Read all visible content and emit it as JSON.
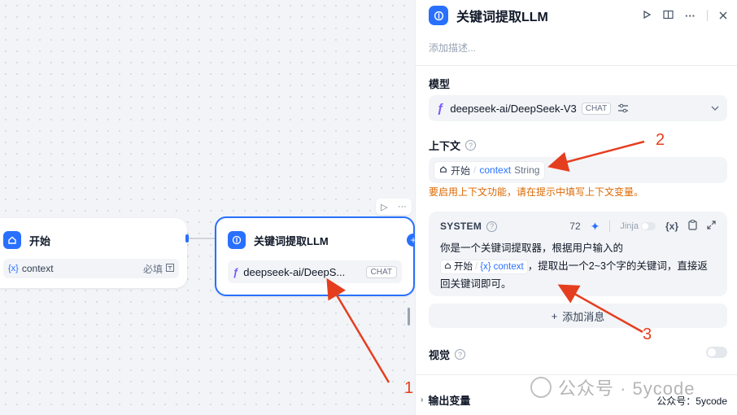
{
  "canvas": {
    "start_node": {
      "title": "开始",
      "var_icon": "{x}",
      "var_name": "context",
      "required": "必填"
    },
    "llm_node": {
      "title": "关键词提取LLM",
      "model": "deepseek-ai/DeepS...",
      "badge": "CHAT"
    },
    "node_tools": {
      "run": "▷",
      "more": "···"
    },
    "plus": "+"
  },
  "panel": {
    "title": "关键词提取LLM",
    "description_placeholder": "添加描述...",
    "model_section": {
      "label": "模型",
      "model_name": "deepseek-ai/DeepSeek-V3",
      "badge": "CHAT"
    },
    "context_section": {
      "label": "上下文",
      "node": "开始",
      "var": "context",
      "type": "String",
      "warning": "要启用上下文功能，请在提示中填写上下文变量。"
    },
    "system_section": {
      "label": "SYSTEM",
      "count": "72",
      "jinja": "Jinja",
      "var_icon": "{x}",
      "text_before": "你是一个关键词提取器，根据用户输入的",
      "chip_node": "开始",
      "chip_var_icon": "{x}",
      "chip_var": "context",
      "text_after": "，提取出一个2~3个字的关键词，直接返回关键词即可。"
    },
    "add_message": {
      "icon": "+",
      "label": "添加消息"
    },
    "vision": {
      "label": "视觉",
      "enabled": false
    },
    "output": {
      "label": "输出变量"
    },
    "footer_note": "公众号：5ycode"
  },
  "watermark": {
    "text": "公众号 · 5ycode"
  },
  "annotations": {
    "one": "1",
    "two": "2",
    "three": "3",
    "color": "#e53e1f"
  },
  "icons": {
    "node_icon": "home-icon",
    "llm_icon": "llm-brain-icon",
    "play": "play-icon",
    "book": "book-icon",
    "more": "more-icon",
    "close": "close-icon",
    "settings": "sliders-icon",
    "chevron": "chevron-down-icon",
    "sparkle": "sparkle-icon",
    "copy": "copy-icon",
    "expand": "expand-icon"
  }
}
